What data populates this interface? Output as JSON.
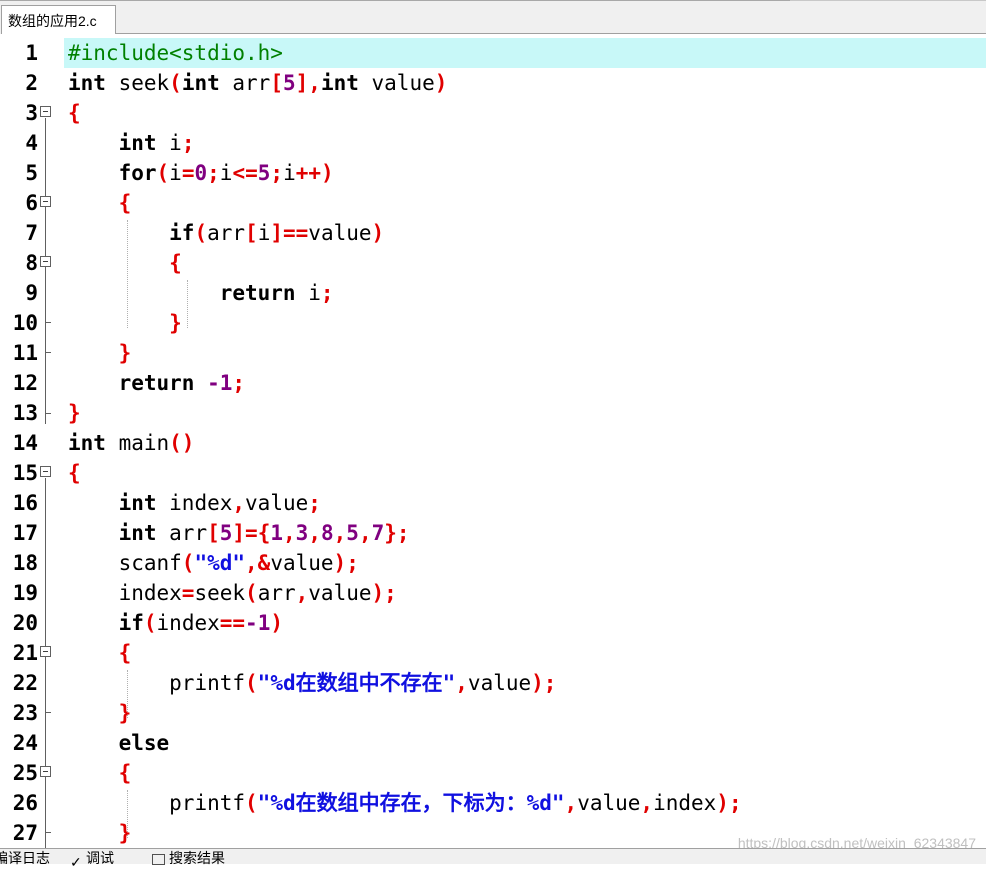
{
  "tab": {
    "label": "数组的应用2.c"
  },
  "editor": {
    "current_line": 1,
    "lines": [
      {
        "n": "1"
      },
      {
        "n": "2"
      },
      {
        "n": "3"
      },
      {
        "n": "4"
      },
      {
        "n": "5"
      },
      {
        "n": "6"
      },
      {
        "n": "7"
      },
      {
        "n": "8"
      },
      {
        "n": "9"
      },
      {
        "n": "10"
      },
      {
        "n": "11"
      },
      {
        "n": "12"
      },
      {
        "n": "13"
      },
      {
        "n": "14"
      },
      {
        "n": "15"
      },
      {
        "n": "16"
      },
      {
        "n": "17"
      },
      {
        "n": "18"
      },
      {
        "n": "19"
      },
      {
        "n": "20"
      },
      {
        "n": "21"
      },
      {
        "n": "22"
      },
      {
        "n": "23"
      },
      {
        "n": "24"
      },
      {
        "n": "25"
      },
      {
        "n": "26"
      },
      {
        "n": "27"
      }
    ],
    "code": {
      "l1": "#include<stdio.h>",
      "l2_kw1": "int",
      "l2_a": " seek",
      "l2_p1": "(",
      "l2_kw2": "int",
      "l2_b": " arr",
      "l2_br1": "[",
      "l2_num": "5",
      "l2_br2": "],",
      "l2_kw3": "int",
      "l2_c": " value",
      "l2_p2": ")",
      "l3": "{",
      "l4_kw": "int",
      "l4_a": " i",
      "l4_semi": ";",
      "l5_kw": "for",
      "l5_p1": "(",
      "l5_a": "i",
      "l5_eq": "=",
      "l5_n0": "0",
      "l5_s1": ";",
      "l5_b": "i",
      "l5_le": "<=",
      "l5_n5": "5",
      "l5_s2": ";",
      "l5_c": "i",
      "l5_pp": "++)",
      "l6": "{",
      "l7_kw": "if",
      "l7_p1": "(",
      "l7_a": "arr",
      "l7_b1": "[",
      "l7_i": "i",
      "l7_b2": "]==",
      "l7_v": "value",
      "l7_p2": ")",
      "l8": "{",
      "l9_kw": "return",
      "l9_a": " i",
      "l9_s": ";",
      "l10": "}",
      "l11": "}",
      "l12_kw": "return",
      "l12_sp": " ",
      "l12_num": "-1",
      "l12_s": ";",
      "l13": "}",
      "l14_kw": "int",
      "l14_a": " main",
      "l14_p": "()",
      "l15": "{",
      "l16_kw": "int",
      "l16_a": " index",
      "l16_c": ",",
      "l16_b": "value",
      "l16_s": ";",
      "l17_kw": "int",
      "l17_a": " arr",
      "l17_o1": "[",
      "l17_n5": "5",
      "l17_o2": "]={",
      "l17_n1": "1",
      "l17_c1": ",",
      "l17_n3": "3",
      "l17_c2": ",",
      "l17_n8": "8",
      "l17_c3": ",",
      "l17_n5b": "5",
      "l17_c4": ",",
      "l17_n7": "7",
      "l17_o3": "};",
      "l18_a": "scanf",
      "l18_p1": "(",
      "l18_str": "\"%d\"",
      "l18_o": ",&",
      "l18_b": "value",
      "l18_p2": ");",
      "l19_a": "index",
      "l19_eq": "=",
      "l19_b": "seek",
      "l19_p1": "(",
      "l19_c": "arr",
      "l19_cm": ",",
      "l19_d": "value",
      "l19_p2": ");",
      "l20_kw": "if",
      "l20_p1": "(",
      "l20_a": "index",
      "l20_op": "==",
      "l20_num": "-1",
      "l20_p2": ")",
      "l21": "{",
      "l22_a": "printf",
      "l22_p1": "(",
      "l22_q1": "\"%d",
      "l22_cjk": "在数组中不存在",
      "l22_q2": "\"",
      "l22_cm": ",",
      "l22_b": "value",
      "l22_p2": ");",
      "l23": "}",
      "l24_kw": "else",
      "l25": "{",
      "l26_a": "printf",
      "l26_p1": "(",
      "l26_q1": "\"%d",
      "l26_cjk": "在数组中存在，下标为：",
      "l26_q2": "%d\"",
      "l26_cm": ",",
      "l26_b": "value",
      "l26_cm2": ",",
      "l26_c": "index",
      "l26_p2": ");",
      "l27": "}"
    }
  },
  "bottom_tabs": {
    "compile_log": "编译日志",
    "debug": "调试",
    "search_results": "搜索结果"
  },
  "watermark": "https://blog.csdn.net/weixin_62343847"
}
